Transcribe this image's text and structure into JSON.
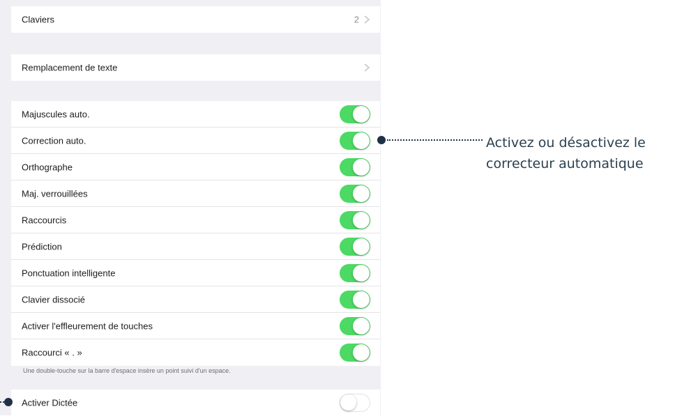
{
  "keyboards_group": {
    "label": "Claviers",
    "count": "2"
  },
  "replacement_group": {
    "label": "Remplacement de texte"
  },
  "toggles": [
    {
      "label": "Majuscules auto.",
      "on": true
    },
    {
      "label": "Correction auto.",
      "on": true
    },
    {
      "label": "Orthographe",
      "on": true
    },
    {
      "label": "Maj. verrouillées",
      "on": true
    },
    {
      "label": "Raccourcis",
      "on": true
    },
    {
      "label": "Prédiction",
      "on": true
    },
    {
      "label": "Ponctuation intelligente",
      "on": true
    },
    {
      "label": "Clavier dissocié",
      "on": true
    },
    {
      "label": "Activer l'effleurement de touches",
      "on": true
    },
    {
      "label": "Raccourci « . »",
      "on": true
    }
  ],
  "footnote": "Une double-touche sur la barre d'espace insère un point suivi d'un espace.",
  "dictation": {
    "label": "Activer Dictée",
    "on": false
  },
  "annotation": {
    "line1": "Activez ou désactivez le",
    "line2": "correcteur automatique"
  },
  "colors": {
    "toggle_on": "#4cd964",
    "annotation_marker": "#1f3146",
    "annotation_text": "#2b3f4e"
  }
}
